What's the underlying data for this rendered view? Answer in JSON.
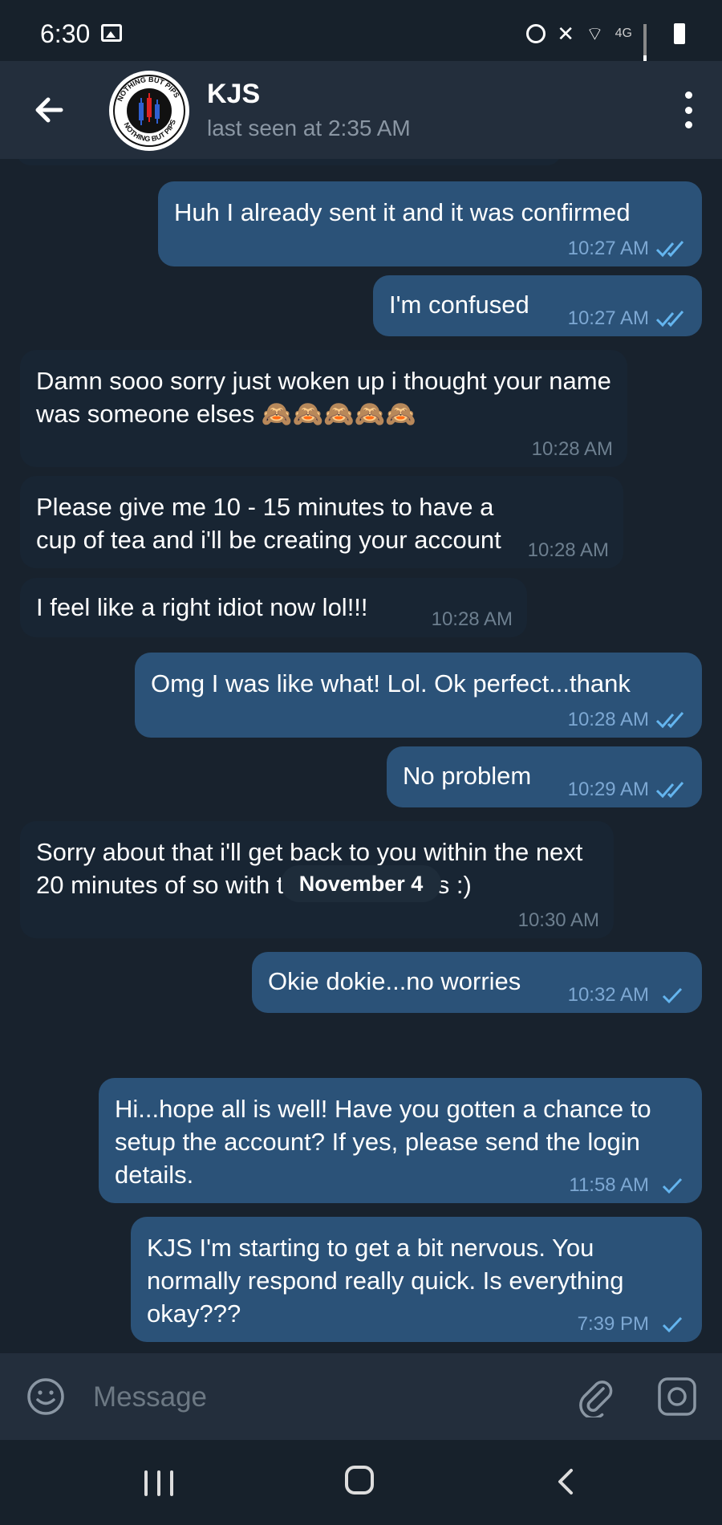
{
  "status_bar": {
    "time": "6:30",
    "network": "4G"
  },
  "header": {
    "name": "KJS",
    "status": "last seen at 2:35 AM",
    "avatar_text": "NOTHING BUT PIPS"
  },
  "messages": [
    {
      "dir": "out",
      "text": "Huh I already sent it and it was confirmed",
      "time": "10:27 AM",
      "ticks": "double"
    },
    {
      "dir": "out",
      "text": "I'm confused",
      "time": "10:27 AM",
      "ticks": "double"
    },
    {
      "dir": "in",
      "text": "Damn sooo sorry just woken up i thought your name was someone elses 🙈🙈🙈🙈🙈",
      "time": "10:28 AM"
    },
    {
      "dir": "in",
      "text": "Please give me 10 - 15 minutes to have a cup of tea and i'll be creating your account",
      "time": "10:28 AM"
    },
    {
      "dir": "in",
      "text": "I feel like a right idiot now lol!!!",
      "time": "10:28 AM"
    },
    {
      "dir": "out",
      "text": "Omg I was like what! Lol. Ok perfect...thank",
      "time": "10:28 AM",
      "ticks": "double"
    },
    {
      "dir": "out",
      "text": "No problem",
      "time": "10:29 AM",
      "ticks": "double"
    },
    {
      "dir": "in",
      "text": "Sorry about that i'll get back to you within the next 20 minutes of so with the login details :)",
      "time": "10:30 AM"
    },
    {
      "dir": "out",
      "text": "Okie dokie...no worries",
      "time": "10:32 AM",
      "ticks": "single"
    },
    {
      "dir": "out",
      "text": "Hi...hope all is well! Have you gotten a chance to setup the account? If yes, please send the login details.",
      "time": "11:58 AM",
      "ticks": "single"
    },
    {
      "dir": "out",
      "text": "KJS I'm starting to get a bit nervous. You normally respond really quick. Is everything okay???",
      "time": "7:39 PM",
      "ticks": "single"
    }
  ],
  "date_divider": "November 4",
  "input": {
    "placeholder": "Message"
  },
  "colors": {
    "outgoing_bubble": "#2b5278",
    "incoming_bubble": "#182533",
    "background": "#18222d",
    "header": "#232e3c",
    "tick": "#64b5ef"
  }
}
